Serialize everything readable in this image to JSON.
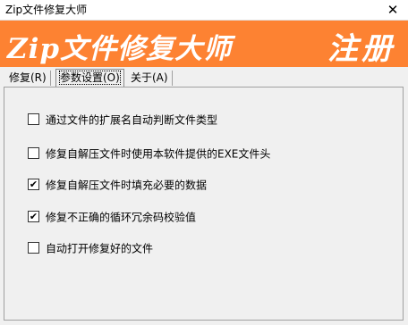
{
  "window": {
    "title": "Zip文件修复大师",
    "close_glyph": "✕"
  },
  "banner": {
    "title": "Zip文件修复大师",
    "register": "注册",
    "bg": "#fd8232"
  },
  "tabs": [
    {
      "label": "修复(R)",
      "active": false
    },
    {
      "label": "参数设置(O)",
      "active": true
    },
    {
      "label": "关于(A)",
      "active": false
    }
  ],
  "options": [
    {
      "label": "通过文件的扩展名自动判断文件类型",
      "checked": false
    },
    {
      "label": "修复自解压文件时使用本软件提供的EXE文件头",
      "checked": false
    },
    {
      "label": "修复自解压文件时填充必要的数据",
      "checked": true
    },
    {
      "label": "修复不正确的循环冗余码校验值",
      "checked": true
    },
    {
      "label": "自动打开修复好的文件",
      "checked": false
    }
  ]
}
